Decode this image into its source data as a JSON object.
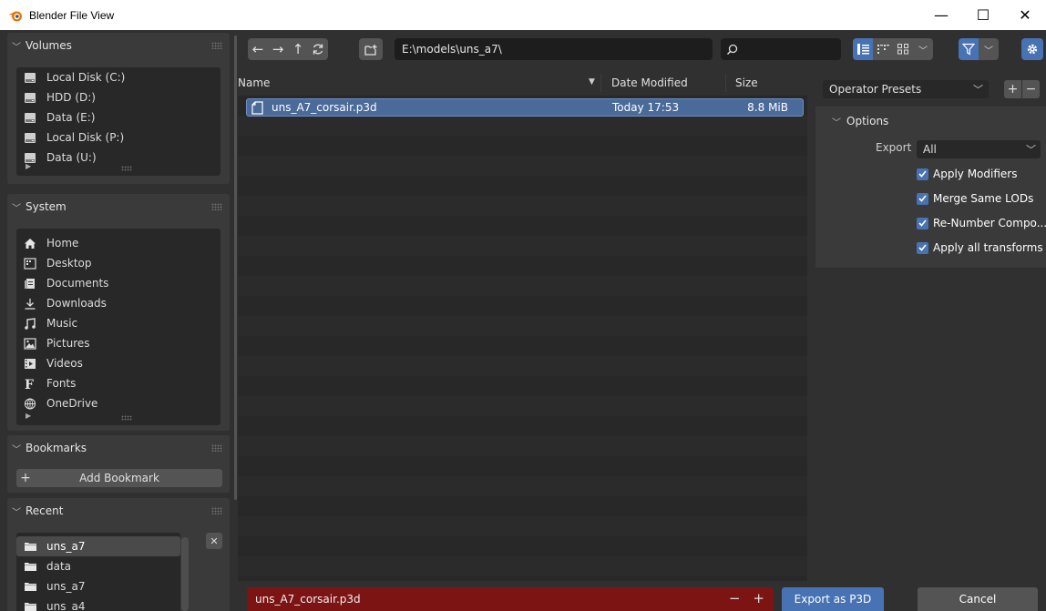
{
  "window": {
    "title": "Blender File View",
    "minimize": "—",
    "maximize": "☐",
    "close": "✕"
  },
  "volumes": {
    "title": "Volumes",
    "items": [
      {
        "label": "Local Disk (C:)",
        "icon": "drive-icon"
      },
      {
        "label": "HDD (D:)",
        "icon": "drive-icon"
      },
      {
        "label": "Data (E:)",
        "icon": "drive-icon"
      },
      {
        "label": "Local Disk (P:)",
        "icon": "drive-icon"
      },
      {
        "label": "Data (U:)",
        "icon": "drive-icon"
      }
    ]
  },
  "system": {
    "title": "System",
    "items": [
      {
        "label": "Home",
        "icon": "home-icon"
      },
      {
        "label": "Desktop",
        "icon": "desktop-icon"
      },
      {
        "label": "Documents",
        "icon": "documents-icon"
      },
      {
        "label": "Downloads",
        "icon": "downloads-icon"
      },
      {
        "label": "Music",
        "icon": "music-icon"
      },
      {
        "label": "Pictures",
        "icon": "pictures-icon"
      },
      {
        "label": "Videos",
        "icon": "videos-icon"
      },
      {
        "label": "Fonts",
        "icon": "fonts-icon"
      },
      {
        "label": "OneDrive",
        "icon": "onedrive-icon"
      }
    ]
  },
  "bookmarks": {
    "title": "Bookmarks",
    "add_label": "Add Bookmark"
  },
  "recent": {
    "title": "Recent",
    "items": [
      {
        "label": "uns_a7",
        "icon": "folder-icon",
        "selected": true
      },
      {
        "label": "data",
        "icon": "folder-icon",
        "selected": false
      },
      {
        "label": "uns_a7",
        "icon": "folder-icon",
        "selected": false
      },
      {
        "label": "uns_a4",
        "icon": "folder-icon",
        "selected": false
      }
    ]
  },
  "toolbar": {
    "path": "E:\\models\\uns_a7\\",
    "search_value": ""
  },
  "file_list": {
    "columns": {
      "name": "Name",
      "date": "Date Modified",
      "size": "Size"
    },
    "files": [
      {
        "name": "uns_A7_corsair.p3d",
        "date": "Today 17:53",
        "size": "8.8 MiB",
        "selected": true
      }
    ]
  },
  "operator": {
    "presets_label": "Operator Presets",
    "options_title": "Options",
    "export_label": "Export",
    "export_value": "All",
    "checks": [
      {
        "label": "Apply Modifiers",
        "checked": true
      },
      {
        "label": "Merge Same LODs",
        "checked": true
      },
      {
        "label": "Re-Number Compo...",
        "checked": true
      },
      {
        "label": "Apply all transforms",
        "checked": true
      }
    ]
  },
  "footer": {
    "filename": "uns_A7_corsair.p3d",
    "export_button": "Export as P3D",
    "cancel_button": "Cancel"
  },
  "colors": {
    "accent": "#4772b3",
    "filename_error": "#7c1414",
    "background": "#303030"
  }
}
